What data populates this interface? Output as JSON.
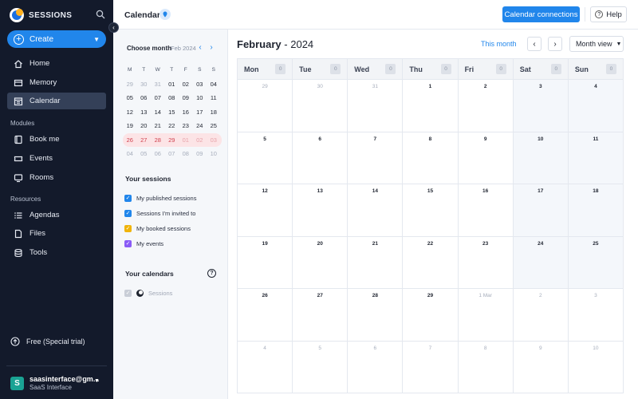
{
  "sidebar": {
    "brand": "SESSIONS",
    "create_label": "Create",
    "nav": [
      {
        "label": "Home",
        "icon": "home-icon"
      },
      {
        "label": "Memory",
        "icon": "memory-icon"
      },
      {
        "label": "Calendar",
        "icon": "calendar-icon",
        "active": true
      }
    ],
    "modules_label": "Modules",
    "modules": [
      {
        "label": "Book me",
        "icon": "book-me-icon"
      },
      {
        "label": "Events",
        "icon": "events-icon"
      },
      {
        "label": "Rooms",
        "icon": "rooms-icon"
      }
    ],
    "resources_label": "Resources",
    "resources": [
      {
        "label": "Agendas",
        "icon": "agendas-icon"
      },
      {
        "label": "Files",
        "icon": "files-icon"
      },
      {
        "label": "Tools",
        "icon": "tools-icon"
      }
    ],
    "trial_label": "Free (Special trial)",
    "account": {
      "initial": "S",
      "email": "saasinterface@gm...",
      "name": "SaaS Interface"
    }
  },
  "topbar": {
    "title": "Calendar",
    "calendar_connections": "Calendar connections",
    "help": "Help"
  },
  "mini_calendar": {
    "heading": "Choose month",
    "month": "Feb 2024",
    "weekdays": [
      "M",
      "T",
      "W",
      "T",
      "F",
      "S",
      "S"
    ],
    "weeks": [
      [
        "29",
        "30",
        "31",
        "01",
        "02",
        "03",
        "04"
      ],
      [
        "05",
        "06",
        "07",
        "08",
        "09",
        "10",
        "11"
      ],
      [
        "12",
        "13",
        "14",
        "15",
        "16",
        "17",
        "18"
      ],
      [
        "19",
        "20",
        "21",
        "22",
        "23",
        "24",
        "25"
      ],
      [
        "26",
        "27",
        "28",
        "29",
        "01",
        "02",
        "03"
      ],
      [
        "04",
        "05",
        "06",
        "07",
        "08",
        "09",
        "10"
      ]
    ]
  },
  "your_sessions": {
    "title": "Your sessions",
    "items": [
      {
        "label": "My published sessions",
        "color": "#2186eb"
      },
      {
        "label": "Sessions I'm invited to",
        "color": "#2186eb"
      },
      {
        "label": "My booked sessions",
        "color": "#f0b40a"
      },
      {
        "label": "My events",
        "color": "#8a5cf6"
      }
    ]
  },
  "your_calendars": {
    "title": "Your calendars",
    "items": [
      {
        "label": "Sessions"
      }
    ]
  },
  "calendar": {
    "month": "February",
    "separator": "-",
    "year": "2024",
    "this_month": "This month",
    "view": "Month view",
    "weekdays": [
      {
        "label": "Mon",
        "count": "0"
      },
      {
        "label": "Tue",
        "count": "0"
      },
      {
        "label": "Wed",
        "count": "0"
      },
      {
        "label": "Thu",
        "count": "0"
      },
      {
        "label": "Fri",
        "count": "0"
      },
      {
        "label": "Sat",
        "count": "0"
      },
      {
        "label": "Sun",
        "count": "0"
      }
    ],
    "weeks": [
      [
        "29",
        "30",
        "31",
        "1",
        "2",
        "3",
        "4"
      ],
      [
        "5",
        "6",
        "7",
        "8",
        "9",
        "10",
        "11"
      ],
      [
        "12",
        "13",
        "14",
        "15",
        "16",
        "17",
        "18"
      ],
      [
        "19",
        "20",
        "21",
        "22",
        "23",
        "24",
        "25"
      ],
      [
        "26",
        "27",
        "28",
        "29",
        "1 Mar",
        "2",
        "3"
      ],
      [
        "4",
        "5",
        "6",
        "7",
        "8",
        "9",
        "10"
      ]
    ]
  },
  "colors": {
    "accent": "#2186eb",
    "sidebar_bg": "#131a2b",
    "leap_highlight": "#fce4e6"
  }
}
